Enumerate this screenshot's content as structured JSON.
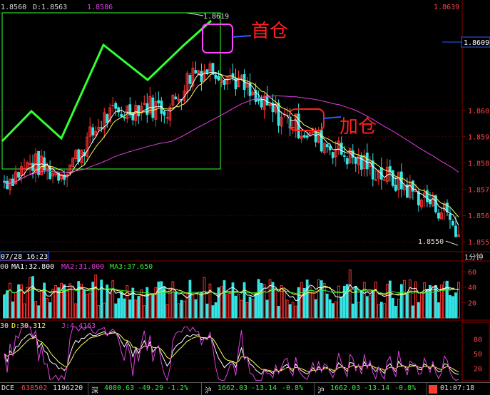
{
  "header": {
    "open_label": "1.8560",
    "d_label": "D:1.8563",
    "close_label": "1.8586",
    "top_right_price": "1.8639"
  },
  "price_axis": {
    "current_price": "1.8609",
    "ticks": [
      "1.860",
      "1.859",
      "1.858",
      "1.857",
      "1.856",
      "1.855"
    ]
  },
  "annotations": {
    "high_mark": "1.8619",
    "low_mark": "1.8550",
    "open_position": "首仓",
    "add_position": "加仓",
    "date_time": "07/28 16:23",
    "period": "1分钟"
  },
  "volume_panel": {
    "prefix": "00",
    "ma1": "MA1:32.800",
    "ma2": "MA2:31.000",
    "ma3": "MA3:37.650",
    "ticks": [
      "60",
      "40",
      "20"
    ]
  },
  "kdj_panel": {
    "prefix": "30",
    "d": "D:30.312",
    "j": "J:4.4163",
    "ticks": [
      "80",
      "50",
      "20"
    ]
  },
  "status_bar": {
    "exchange": "DCE",
    "exchange_val1": "638502",
    "exchange_val2": "1196220",
    "sz_name": "深",
    "sz_index": "4080.63",
    "sz_change": "-49.29",
    "sz_pct": "-1.2%",
    "sh_name": "沪",
    "sh_index": "1662.03",
    "sh_change": "-13.14",
    "sh_pct": "-0.8%",
    "sh2_name": "沪",
    "sh2_index": "1662.03",
    "sh2_change": "-13.14",
    "sh2_pct": "-0.8%",
    "clock": "01:07:18"
  },
  "colors": {
    "up": "#ff3333",
    "down": "#33e6e6",
    "ma_white": "#ffffff",
    "ma_yellow": "#ffff55",
    "ma_purple": "#e040e0",
    "ma_green": "#33ee33",
    "wave": "#33ff33",
    "box": "#33ff33",
    "annotation_red": "#ff2020",
    "annotation_magenta": "#ff44ff",
    "grid_red": "#8b0000"
  },
  "chart_data": {
    "type": "candlestick",
    "y_range": [
      1.8547,
      1.8641
    ],
    "n_bars": 160,
    "price_path": {
      "bar_index": [
        0,
        10,
        18,
        22,
        35,
        48,
        58,
        66,
        74,
        82,
        88,
        100,
        108,
        120,
        140,
        155,
        159
      ],
      "close": [
        1.8573,
        1.858,
        1.8576,
        1.8578,
        1.8597,
        1.8602,
        1.8601,
        1.8615,
        1.8616,
        1.8611,
        1.8603,
        1.8596,
        1.859,
        1.8583,
        1.8571,
        1.8561,
        1.8552
      ]
    },
    "annotated_high": 1.8619,
    "annotated_low": 1.855,
    "current_price": 1.8609,
    "volume_axis": [
      0,
      60
    ],
    "volume_ma": {
      "MA1": 32.8,
      "MA2": 31.0,
      "MA3": 37.65
    },
    "kdj_axis": [
      0,
      100
    ],
    "kdj_last": {
      "D": 30.312,
      "J": 4.4163
    }
  }
}
